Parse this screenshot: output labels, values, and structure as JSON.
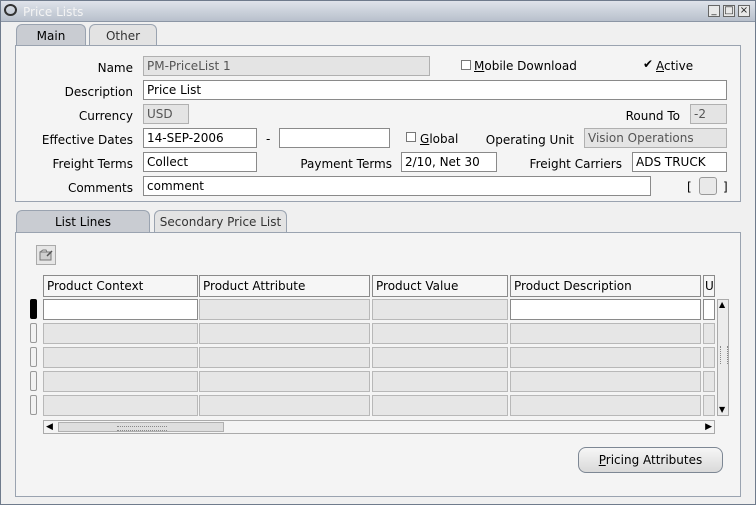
{
  "window": {
    "title": "Price Lists",
    "controls": [
      "_",
      "□",
      "×"
    ]
  },
  "top_tabs": [
    {
      "label": "Main"
    },
    {
      "label": "Other"
    }
  ],
  "form": {
    "name_label": "Name",
    "name_value": "PM-PriceList 1",
    "mobile_download_label": "Mobile Download",
    "mobile_download_checked": false,
    "active_label": "Active",
    "active_checked": true,
    "description_label": "Description",
    "description_value": "Price List",
    "currency_label": "Currency",
    "currency_value": "USD",
    "round_to_label": "Round To",
    "round_to_value": "-2",
    "effective_dates_label": "Effective Dates",
    "effective_from": "14-SEP-2006",
    "date_separator": "-",
    "effective_to": "",
    "global_label": "Global",
    "global_checked": false,
    "operating_unit_label": "Operating Unit",
    "operating_unit_value": "Vision Operations",
    "freight_terms_label": "Freight Terms",
    "freight_terms_value": "Collect",
    "payment_terms_label": "Payment Terms",
    "payment_terms_value": "2/10, Net 30",
    "freight_carriers_label": "Freight Carriers",
    "freight_carriers_value": "ADS TRUCK",
    "comments_label": "Comments",
    "comments_value": "comment",
    "bracket_left": "[",
    "bracket_right": "]"
  },
  "lower_tabs": [
    {
      "label": "List Lines"
    },
    {
      "label": "Secondary Price List"
    }
  ],
  "grid": {
    "columns": [
      "Product Context",
      "Product Attribute",
      "Product Value",
      "Product Description",
      "U"
    ],
    "row_count": 5
  },
  "buttons": {
    "pricing_attributes": "Pricing Attributes"
  }
}
